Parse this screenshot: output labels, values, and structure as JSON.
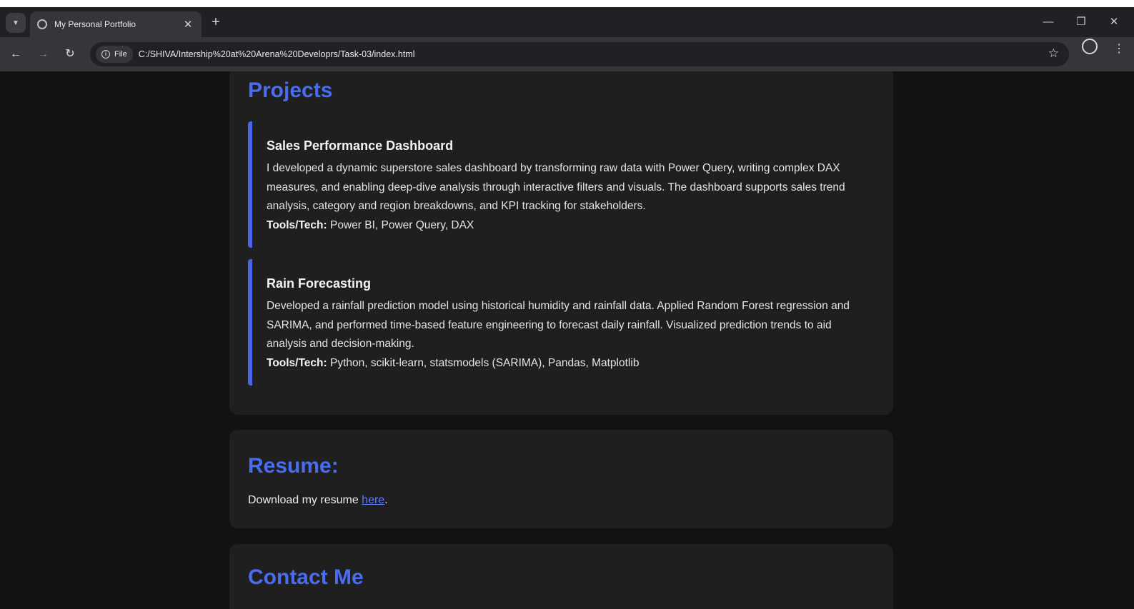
{
  "browser": {
    "tab_title": "My Personal Portfolio",
    "tab_close": "✕",
    "new_tab": "+",
    "scheme_chip": "File",
    "url": "C:/SHIVA/Intership%20at%20Arena%20Developrs/Task-03/index.html",
    "icons": [
      "tab-search-icon",
      "globe-icon",
      "close-icon",
      "plus-icon",
      "minimize-icon",
      "restore-icon",
      "window-close-icon",
      "back-icon",
      "forward-icon",
      "reload-icon",
      "info-icon",
      "star-icon",
      "profile-icon",
      "kebab-menu-icon"
    ]
  },
  "projects": {
    "heading": "Projects",
    "items": [
      {
        "title": "Sales Performance Dashboard",
        "description": "I developed a dynamic superstore sales dashboard by transforming raw data with Power Query, writing complex DAX measures, and enabling deep-dive analysis through interactive filters and visuals. The dashboard supports sales trend analysis, category and region breakdowns, and KPI tracking for stakeholders.",
        "tools_label": "Tools/Tech:",
        "tools": " Power BI, Power Query, DAX"
      },
      {
        "title": "Rain Forecasting",
        "description": "Developed a rainfall prediction model using historical humidity and rainfall data. Applied Random Forest regression and SARIMA, and performed time-based feature engineering to forecast daily rainfall. Visualized prediction trends to aid analysis and decision-making.",
        "tools_label": "Tools/Tech:",
        "tools": " Python, scikit-learn, statsmodels (SARIMA), Pandas, Matplotlib"
      }
    ]
  },
  "resume": {
    "heading": "Resume:",
    "text_before": "Download my resume ",
    "link_text": "here",
    "text_after": "."
  },
  "contact": {
    "heading": "Contact Me"
  },
  "colors": {
    "accent": "#4a6cf0",
    "background": "#121212",
    "card": "#1f1f1f"
  }
}
